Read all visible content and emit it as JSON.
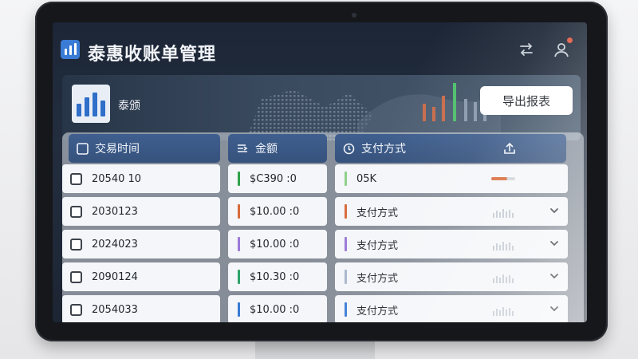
{
  "app": {
    "title": "泰惠收账单管理"
  },
  "header": {
    "icons": [
      "swap-icon",
      "user-icon"
    ],
    "has_notification": true
  },
  "banner": {
    "label": "泰颁",
    "export_label": "导出报表"
  },
  "table": {
    "columns": [
      {
        "label": "交易时间",
        "icon": "checkbox-icon"
      },
      {
        "label": "金额",
        "icon": "sort-icon"
      },
      {
        "label": "支付方式",
        "icon": "clock-icon"
      },
      {
        "label": "",
        "icon": "upload-icon"
      }
    ],
    "rows": [
      {
        "date": "20540 10",
        "amount": "$C390 :0",
        "amount_color": "#2fa34a",
        "method": "05K",
        "method_color": "#8fd08a",
        "trail": "bar",
        "expand": false
      },
      {
        "date": "2030123",
        "amount": "$10.00 :0",
        "amount_color": "#d96b3c",
        "method": "支付方式",
        "method_color": "#d96b3c",
        "trail": "spark",
        "expand": true
      },
      {
        "date": "2024023",
        "amount": "$10.00 :0",
        "amount_color": "#9b7ad8",
        "method": "支付方式",
        "method_color": "#9b7ad8",
        "trail": "spark",
        "expand": true
      },
      {
        "date": "2090124",
        "amount": "$10.30 :0",
        "amount_color": "#2fa36a",
        "method": "支付方式",
        "method_color": "#a8b6cc",
        "trail": "spark",
        "expand": true
      },
      {
        "date": "2054033",
        "amount": "$10.00 :0",
        "amount_color": "#3a7bd5",
        "method": "支付方式",
        "method_color": "#3a7bd5",
        "trail": "spark",
        "expand": true
      }
    ]
  },
  "colors": {
    "accent": "#3a7bd5",
    "header_bg": "#3f5f8f",
    "notification": "#e2543a"
  }
}
